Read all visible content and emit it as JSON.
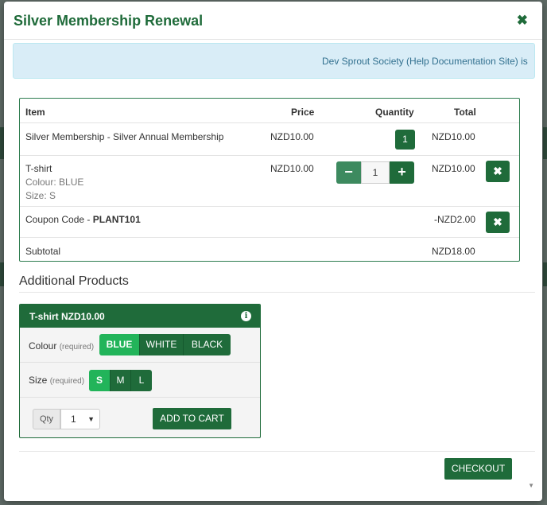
{
  "modal": {
    "title": "Silver Membership Renewal",
    "close": "✖",
    "banner": "Dev Sprout Society (Help Documentation Site) is"
  },
  "cart": {
    "headers": {
      "item": "Item",
      "price": "Price",
      "quantity": "Quantity",
      "total": "Total"
    },
    "rows": [
      {
        "item": "Silver Membership - Silver Annual Membership",
        "price": "NZD10.00",
        "qty": "1",
        "total": "NZD10.00"
      },
      {
        "item": "T-shirt",
        "colour": "Colour: BLUE",
        "size": "Size: S",
        "price": "NZD10.00",
        "qty": "1",
        "total": "NZD10.00",
        "minus": "−",
        "plus": "+"
      },
      {
        "item_prefix": "Coupon Code - ",
        "code": "PLANT101",
        "total": "-NZD2.00"
      }
    ],
    "subtotal_label": "Subtotal",
    "subtotal": "NZD18.00",
    "remove": "✖"
  },
  "additional": {
    "title": "Additional Products",
    "product": {
      "name": "T-shirt NZD10.00",
      "info": "i",
      "colour_label": "Colour",
      "colour_required": "(required)",
      "colours": [
        "BLUE",
        "WHITE",
        "BLACK"
      ],
      "size_label": "Size",
      "size_required": "(required)",
      "sizes": [
        "S",
        "M",
        "L"
      ],
      "qty_label": "Qty",
      "qty_value": "1",
      "add_to_cart": "ADD TO CART"
    }
  },
  "checkout": "CHECKOUT",
  "colors": {
    "brand": "#1f6b3a",
    "active": "#22b45a",
    "banner": "#d9edf7"
  }
}
